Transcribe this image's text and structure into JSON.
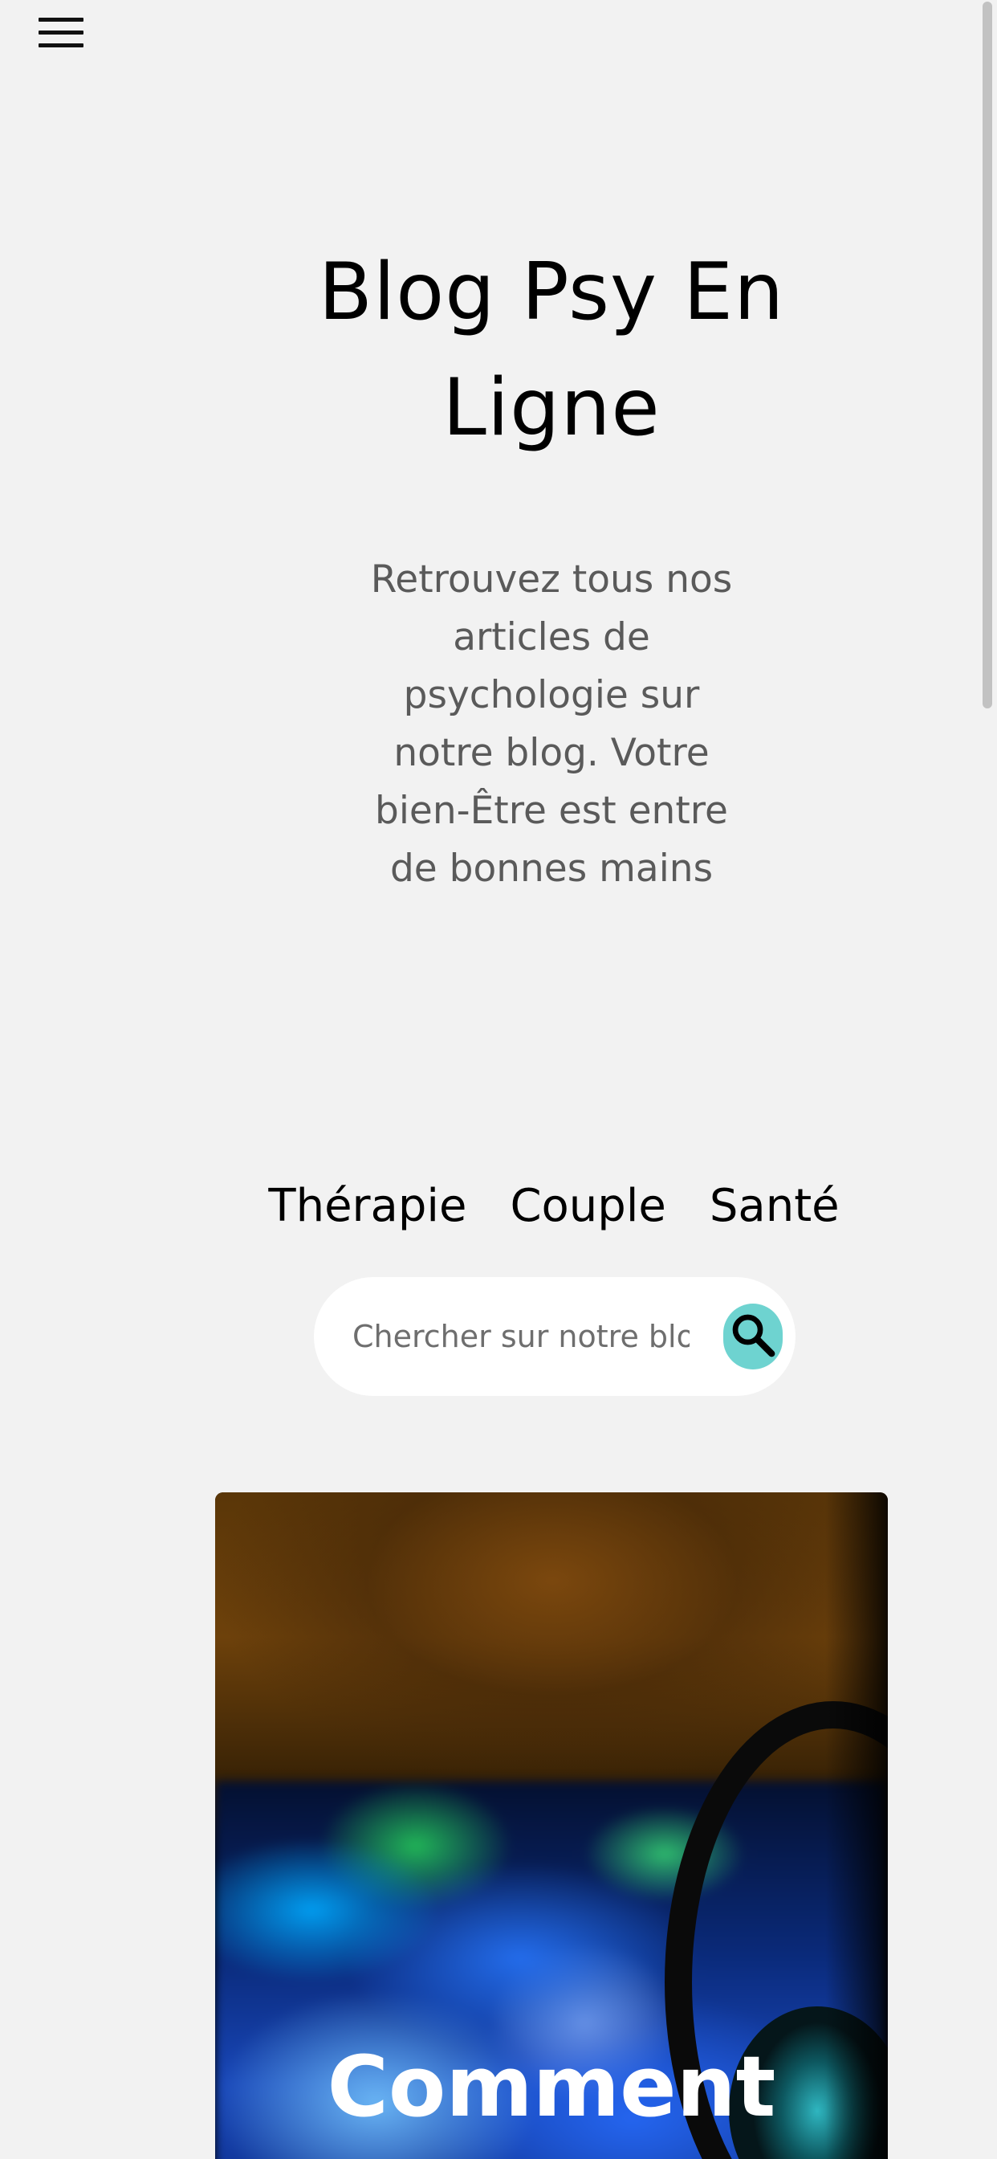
{
  "header": {
    "menu_icon": "hamburger-menu-icon"
  },
  "site": {
    "title": "Blog Psy En Ligne",
    "tagline": "Retrouvez tous nos articles de psychologie sur notre blog. Votre bien-Être est entre de bonnes mains"
  },
  "categories": [
    {
      "label": "Thérapie"
    },
    {
      "label": "Couple"
    },
    {
      "label": "Santé"
    }
  ],
  "search": {
    "placeholder": "Chercher sur notre blog",
    "button_icon": "search-icon",
    "button_color": "#6ed3d0"
  },
  "featured_post": {
    "title": "Comment"
  },
  "colors": {
    "background": "#f2f2f2",
    "accent": "#6ed3d0"
  }
}
